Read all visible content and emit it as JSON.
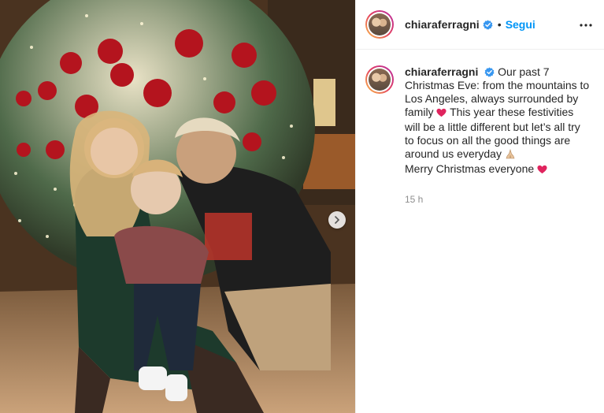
{
  "post": {
    "username": "chiaraferragni",
    "follow_label": "Segui",
    "dot": "•",
    "caption_parts": [
      "Our past 7 Christmas Eve: from the mountains to Los Angeles, always surrounded by family",
      "This year these festivities will be a little different but let’s all try to focus on all the good things are around us everyday",
      "Merry Christmas everyone"
    ],
    "timestamp": "15 h"
  },
  "icons": {
    "verified": "verified-badge-icon",
    "more": "more-options-icon",
    "next": "chevron-right-icon",
    "heart": "red-heart-icon",
    "hands": "folded-hands-icon"
  },
  "colors": {
    "accent": "#0095f6",
    "heart": "#e0245e",
    "muted": "#8e8e8e"
  }
}
